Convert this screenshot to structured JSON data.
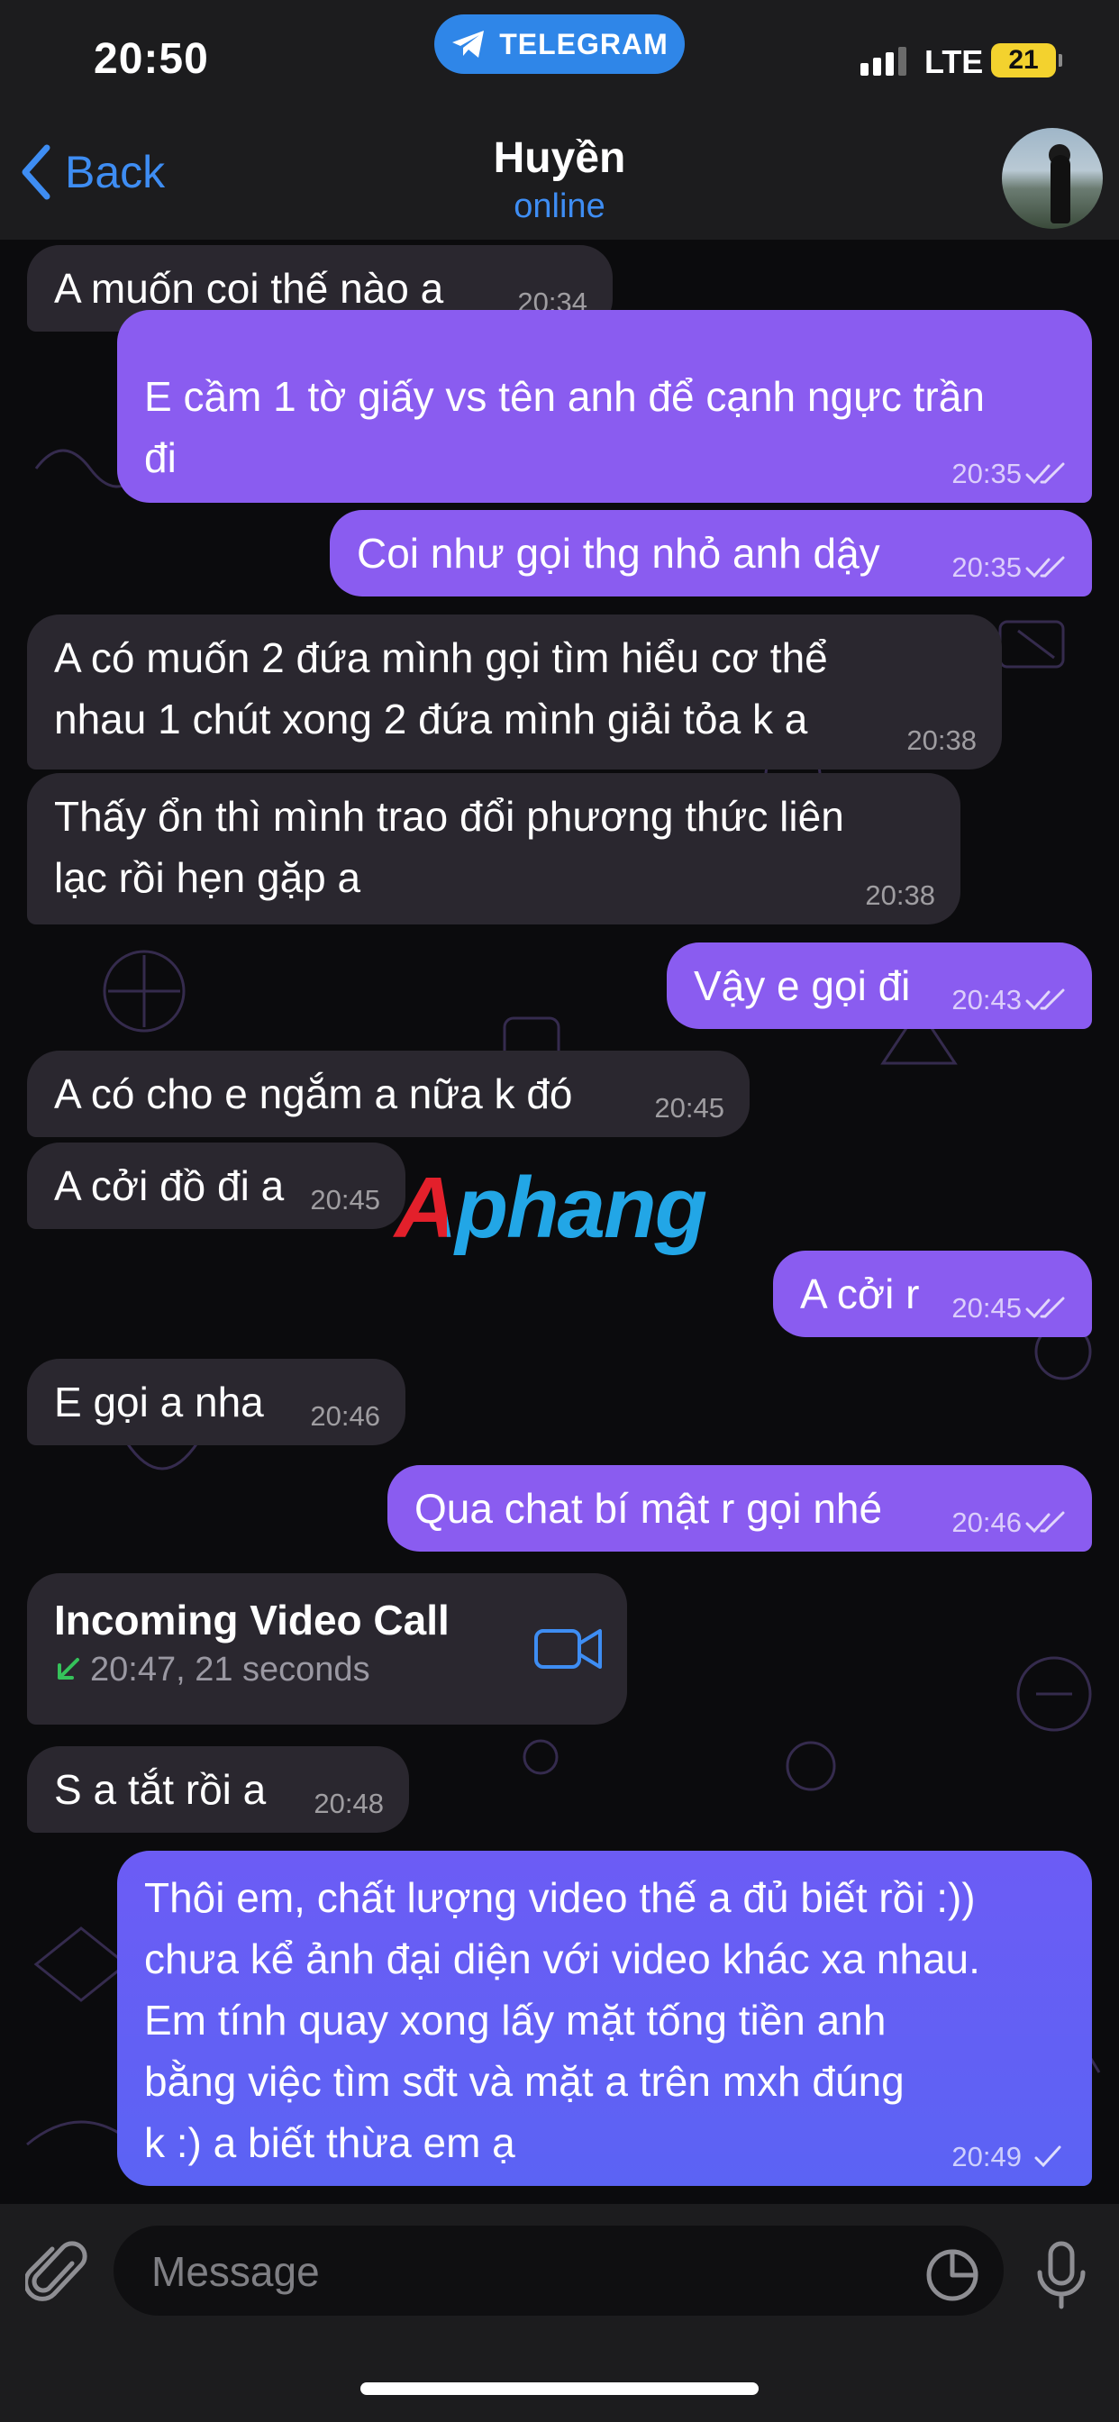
{
  "status_bar": {
    "time": "20:50",
    "app_pill": "TELEGRAM",
    "network": "LTE",
    "battery": "21"
  },
  "header": {
    "back_label": "Back",
    "contact_name": "Huyền",
    "contact_status": "online"
  },
  "messages": [
    {
      "dir": "in",
      "text": "A muốn coi thế nào a",
      "time": "20:34"
    },
    {
      "dir": "out",
      "text": "E cầm 1 tờ giấy vs tên anh để cạnh ngực trần\nđi",
      "time": "20:35"
    },
    {
      "dir": "out",
      "text": "Coi như gọi thg nhỏ anh dậy",
      "time": "20:35"
    },
    {
      "dir": "in",
      "text": "A có muốn 2 đứa mình gọi tìm hiểu cơ thể\nnhau 1 chút xong 2 đứa mình giải tỏa k a",
      "time": "20:38"
    },
    {
      "dir": "in",
      "text": "Thấy ổn thì mình trao đổi phương thức liên\nlạc rồi hẹn gặp a",
      "time": "20:38"
    },
    {
      "dir": "out",
      "text": "Vậy e gọi đi",
      "time": "20:43"
    },
    {
      "dir": "in",
      "text": "A có cho e ngắm a nữa k đó",
      "time": "20:45"
    },
    {
      "dir": "in",
      "text": "A cởi đồ đi a",
      "time": "20:45"
    },
    {
      "dir": "out",
      "text": "A cởi r",
      "time": "20:45"
    },
    {
      "dir": "in",
      "text": "E gọi a nha",
      "time": "20:46"
    },
    {
      "dir": "out",
      "text": "Qua chat bí mật r gọi nhé",
      "time": "20:46"
    },
    {
      "dir": "in",
      "text": "S a tắt rồi a",
      "time": "20:48"
    },
    {
      "dir": "out",
      "text": "Thôi em, chất lượng video thế a đủ biết rồi :))\nchưa kể ảnh đại diện với video khác xa nhau.\nEm tính quay xong lấy mặt tống tiền anh\nbằng việc tìm sđt và mặt a trên mxh đúng\nk :) a biết thừa em ạ",
      "time": "20:49"
    }
  ],
  "call": {
    "title": "Incoming Video Call",
    "detail": "20:47, 21 seconds"
  },
  "watermark": "Aphang",
  "composer": {
    "placeholder": "Message"
  },
  "colors": {
    "accent": "#3e8df3",
    "outgoing_bubble": "#8a5cf0",
    "incoming_bubble": "#2a272f"
  },
  "icons": [
    "telegram-plane-icon",
    "chevron-left-icon",
    "double-check-icon",
    "single-check-icon",
    "incoming-arrow-icon",
    "video-camera-icon",
    "paperclip-icon",
    "sticker-icon",
    "microphone-icon"
  ]
}
